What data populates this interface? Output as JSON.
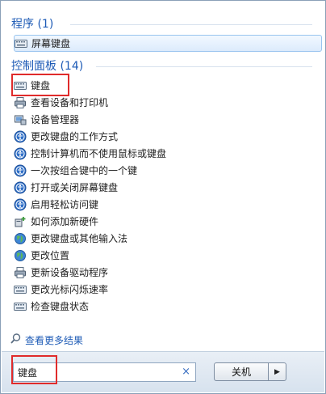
{
  "groups": {
    "programs": {
      "title": "程序 (1)"
    },
    "control_panel": {
      "title": "控制面板 (14)"
    }
  },
  "program_items": [
    {
      "label": "屏幕键盘",
      "icon": "keyboard-icon"
    }
  ],
  "control_items": [
    {
      "label": "键盘",
      "icon": "keyboard-icon"
    },
    {
      "label": "查看设备和打印机",
      "icon": "printer-icon"
    },
    {
      "label": "设备管理器",
      "icon": "device-manager-icon"
    },
    {
      "label": "更改键盘的工作方式",
      "icon": "ease-of-access-icon"
    },
    {
      "label": "控制计算机而不使用鼠标或键盘",
      "icon": "ease-of-access-icon"
    },
    {
      "label": "一次按组合键中的一个键",
      "icon": "ease-of-access-icon"
    },
    {
      "label": "打开或关闭屏幕键盘",
      "icon": "ease-of-access-icon"
    },
    {
      "label": "启用轻松访问键",
      "icon": "ease-of-access-icon"
    },
    {
      "label": "如何添加新硬件",
      "icon": "hardware-icon"
    },
    {
      "label": "更改键盘或其他输入法",
      "icon": "globe-icon"
    },
    {
      "label": "更改位置",
      "icon": "globe-icon"
    },
    {
      "label": "更新设备驱动程序",
      "icon": "printer-icon"
    },
    {
      "label": "更改光标闪烁速率",
      "icon": "keyboard-icon"
    },
    {
      "label": "检查键盘状态",
      "icon": "keyboard-icon"
    }
  ],
  "see_more": "查看更多结果",
  "search": {
    "value": "键盘",
    "clear": "×"
  },
  "shutdown": {
    "label": "关机",
    "arrow": "▶"
  },
  "colors": {
    "accent": "#1e5bb6",
    "highlight": "#e02b2b"
  }
}
